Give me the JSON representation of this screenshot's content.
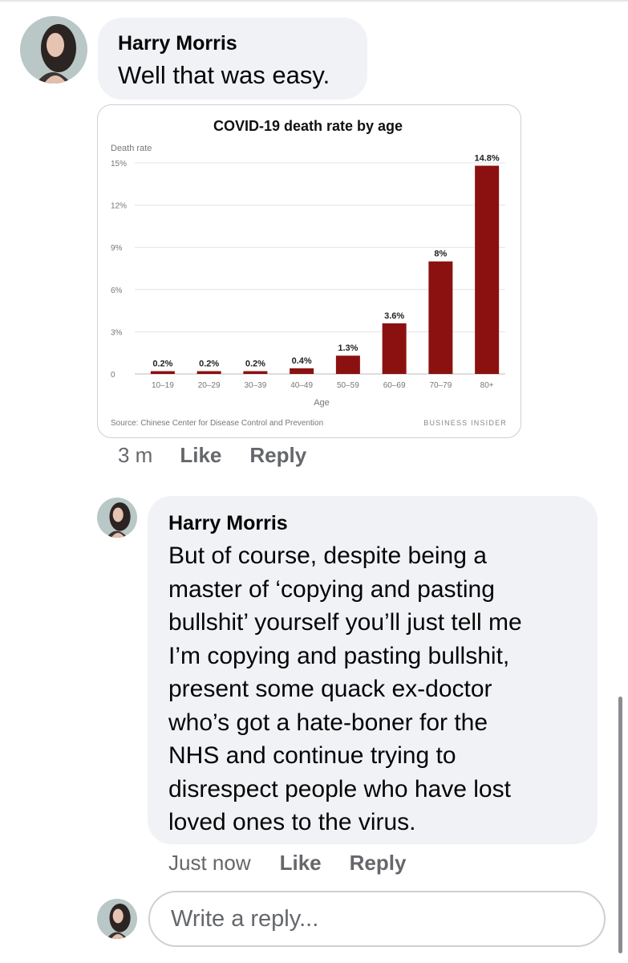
{
  "comment1": {
    "author": "Harry Morris",
    "text": "Well that was easy.",
    "time": "3 m",
    "like_label": "Like",
    "reply_label": "Reply"
  },
  "chart_data": {
    "type": "bar",
    "title": "COVID-19 death rate by age",
    "ylabel": "Death rate",
    "xlabel": "Age",
    "categories": [
      "10–19",
      "20–29",
      "30–39",
      "40–49",
      "50–59",
      "60–69",
      "70–79",
      "80+"
    ],
    "values": [
      0.2,
      0.2,
      0.2,
      0.4,
      1.3,
      3.6,
      8,
      14.8
    ],
    "data_labels": [
      "0.2%",
      "0.2%",
      "0.2%",
      "0.4%",
      "1.3%",
      "3.6%",
      "8%",
      "14.8%"
    ],
    "yticks": [
      0,
      3,
      6,
      9,
      12,
      15
    ],
    "ytick_labels": [
      "0",
      "3%",
      "6%",
      "9%",
      "12%",
      "15%"
    ],
    "ylim": [
      0,
      15
    ],
    "grid": true,
    "bar_color": "#8b1111",
    "source": "Source: Chinese Center for Disease Control and Prevention",
    "brand": "BUSINESS INSIDER"
  },
  "comment2": {
    "author": "Harry Morris",
    "lines": [
      "But of course, despite being a",
      "master of ‘copying and pasting",
      "bullshit’ yourself you’ll just tell me",
      "I’m copying and pasting bullshit,",
      "present some quack ex-doctor",
      "who’s got a hate-boner for the",
      "NHS and continue trying to",
      "disrespect people who have lost",
      "loved ones to the virus."
    ],
    "time": "Just now",
    "like_label": "Like",
    "reply_label": "Reply"
  },
  "reply_input": {
    "placeholder": "Write a reply..."
  },
  "colors": {
    "bubble": "#f0f2f5",
    "meta_text": "#65676b",
    "bar": "#8b1111"
  },
  "icons": {
    "avatar": "profile-photo"
  }
}
